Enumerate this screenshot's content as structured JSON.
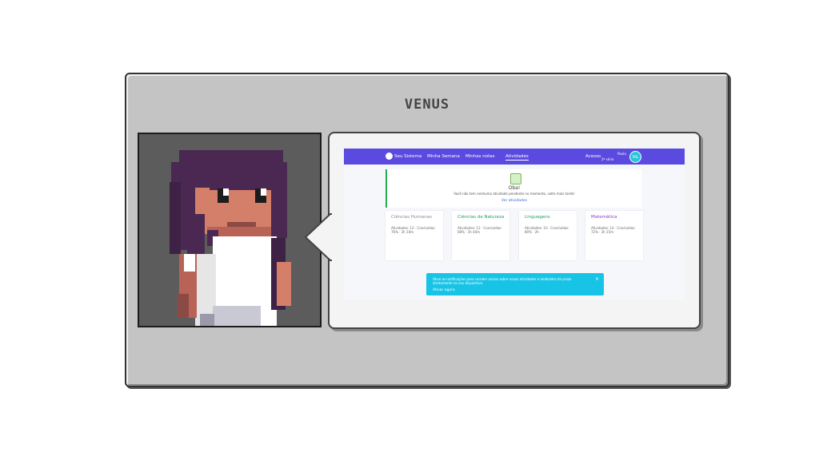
{
  "character": {
    "name": "VENUS"
  },
  "screen": {
    "nav": {
      "items": [
        {
          "label": "Seu Sistema"
        },
        {
          "label": "Minha Semana"
        },
        {
          "label": "Minhas notas"
        },
        {
          "label": "Atividades"
        }
      ],
      "right_text": "Acesso",
      "user_line1": "Paula",
      "user_line2": "2ª série",
      "avatar_text": "PBL"
    },
    "empty_state": {
      "title": "Oba!",
      "message": "Você não tem nenhuma atividade pendente no momento, volte mais tarde!",
      "link": "Ver atividades"
    },
    "subjects": [
      {
        "title": "Ciências Humanas",
        "detail": "Atividades: 12 · Concluídas: 76% · 2h 10m",
        "color": "#8a8a8a"
      },
      {
        "title": "Ciências da Natureza",
        "detail": "Atividades: 12 · Concluídas: 68% · 1h 40m",
        "color": "#1f9e6a"
      },
      {
        "title": "Linguagens",
        "detail": "Atividades: 10 · Concluídas: 80% · 2h",
        "color": "#1f9e6a"
      },
      {
        "title": "Matemática",
        "detail": "Atividades: 14 · Concluídas: 72% · 2h 15m",
        "color": "#8a3bd1"
      }
    ],
    "banner": {
      "text": "Ative as notificações para receber avisos sobre novas atividades e lembretes de prazo diretamente no seu dispositivo.",
      "link": "Ativar agora",
      "close": "×"
    }
  },
  "colors": {
    "panel": "#c4c4c4",
    "nav": "#5b4ae0",
    "banner": "#18c4e6"
  }
}
